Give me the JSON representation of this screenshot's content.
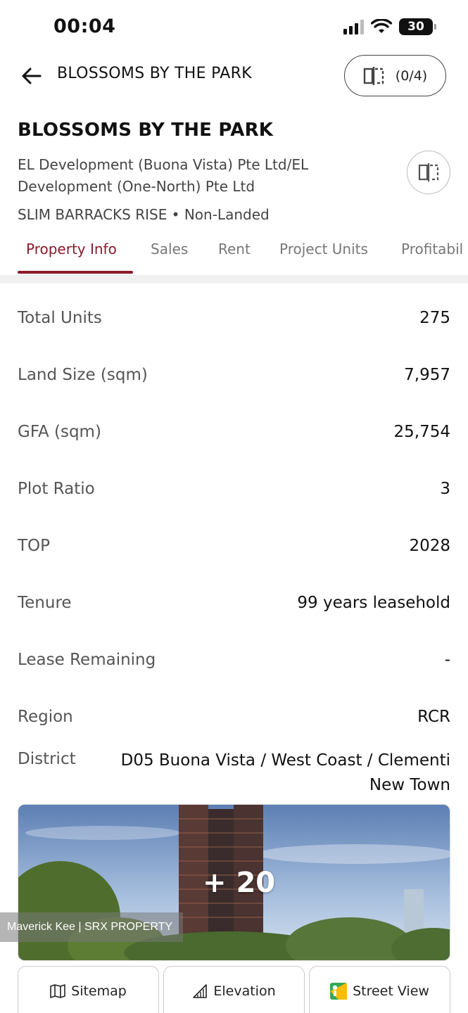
{
  "status": {
    "time": "00:04",
    "battery": "30",
    "icons": [
      "signal-icon",
      "wifi-icon",
      "battery-icon"
    ]
  },
  "nav": {
    "title": "BLOSSOMS BY THE PARK",
    "compare_count": "(0/4)"
  },
  "project": {
    "name": "BLOSSOMS BY THE PARK",
    "developer": "EL Development (Buona Vista) Pte Ltd/EL Development (One-North) Pte Ltd",
    "location": "SLIM BARRACKS RISE • Non-Landed"
  },
  "tabs": [
    {
      "label": "Property Info",
      "active": true
    },
    {
      "label": "Sales",
      "active": false
    },
    {
      "label": "Rent",
      "active": false
    },
    {
      "label": "Project Units",
      "active": false
    },
    {
      "label": "Profitabil",
      "active": false
    }
  ],
  "info": [
    {
      "label": "Total Units",
      "value": "275"
    },
    {
      "label": "Land Size (sqm)",
      "value": "7,957"
    },
    {
      "label": "GFA (sqm)",
      "value": "25,754"
    },
    {
      "label": "Plot Ratio",
      "value": "3"
    },
    {
      "label": "TOP",
      "value": "2028"
    },
    {
      "label": "Tenure",
      "value": "99 years leasehold"
    },
    {
      "label": "Lease Remaining",
      "value": "-"
    },
    {
      "label": "Region",
      "value": "RCR"
    }
  ],
  "district": {
    "label": "District",
    "value": "D05 Buona Vista / West Coast / Clementi New Town"
  },
  "gallery": {
    "more_count": "+ 20",
    "credit": "Maverick Kee | SRX PROPERTY"
  },
  "actions": {
    "sitemap": "Sitemap",
    "elevation": "Elevation",
    "street_view": "Street View"
  },
  "colors": {
    "accent": "#8b1a2b"
  }
}
